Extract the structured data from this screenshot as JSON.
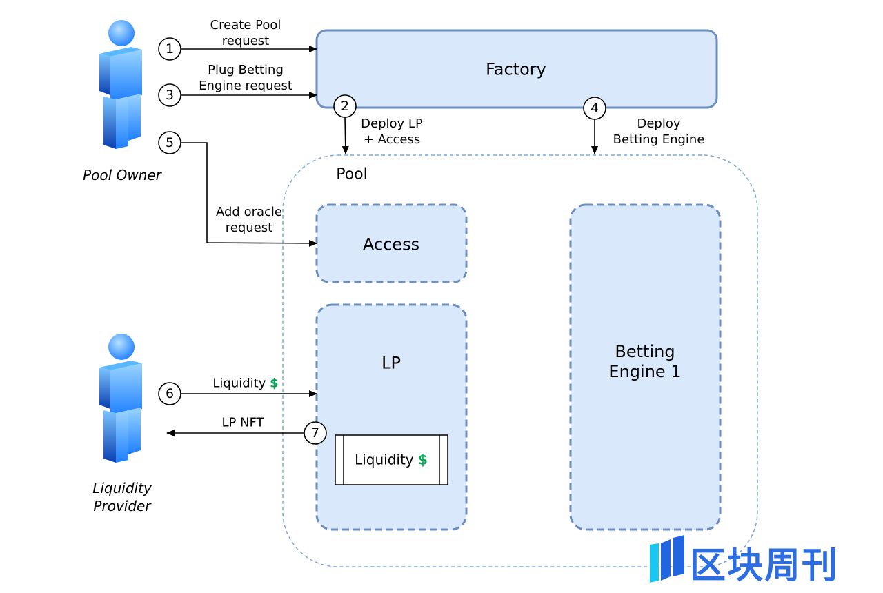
{
  "actors": {
    "pool_owner": "Pool Owner",
    "liquidity_provider": [
      "Liquidity",
      "Provider"
    ]
  },
  "components": {
    "factory": "Factory",
    "pool": "Pool",
    "access": "Access",
    "lp": "LP",
    "betting_engine": [
      "Betting",
      "Engine 1"
    ],
    "liquidity_box": "Liquidity",
    "currency_symbol": "$"
  },
  "steps": [
    {
      "num": "1",
      "label": [
        "Create Pool",
        "request"
      ]
    },
    {
      "num": "2",
      "label": [
        "Deploy LP",
        "+ Access"
      ]
    },
    {
      "num": "3",
      "label": [
        "Plug Betting",
        "Engine request"
      ]
    },
    {
      "num": "4",
      "label": [
        "Deploy",
        "Betting Engine"
      ]
    },
    {
      "num": "5",
      "label": [
        "Add oracle",
        "request"
      ]
    },
    {
      "num": "6",
      "label": [
        "Liquidity"
      ]
    },
    {
      "num": "7",
      "label": [
        "LP NFT"
      ]
    }
  ],
  "watermark": "区块周刊",
  "colors": {
    "box_fill": "#dae8fc",
    "box_stroke": "#6c8ebf",
    "pool_stroke": "#7ea6e0",
    "dollar": "#00a650",
    "person": "#1e7fff"
  }
}
